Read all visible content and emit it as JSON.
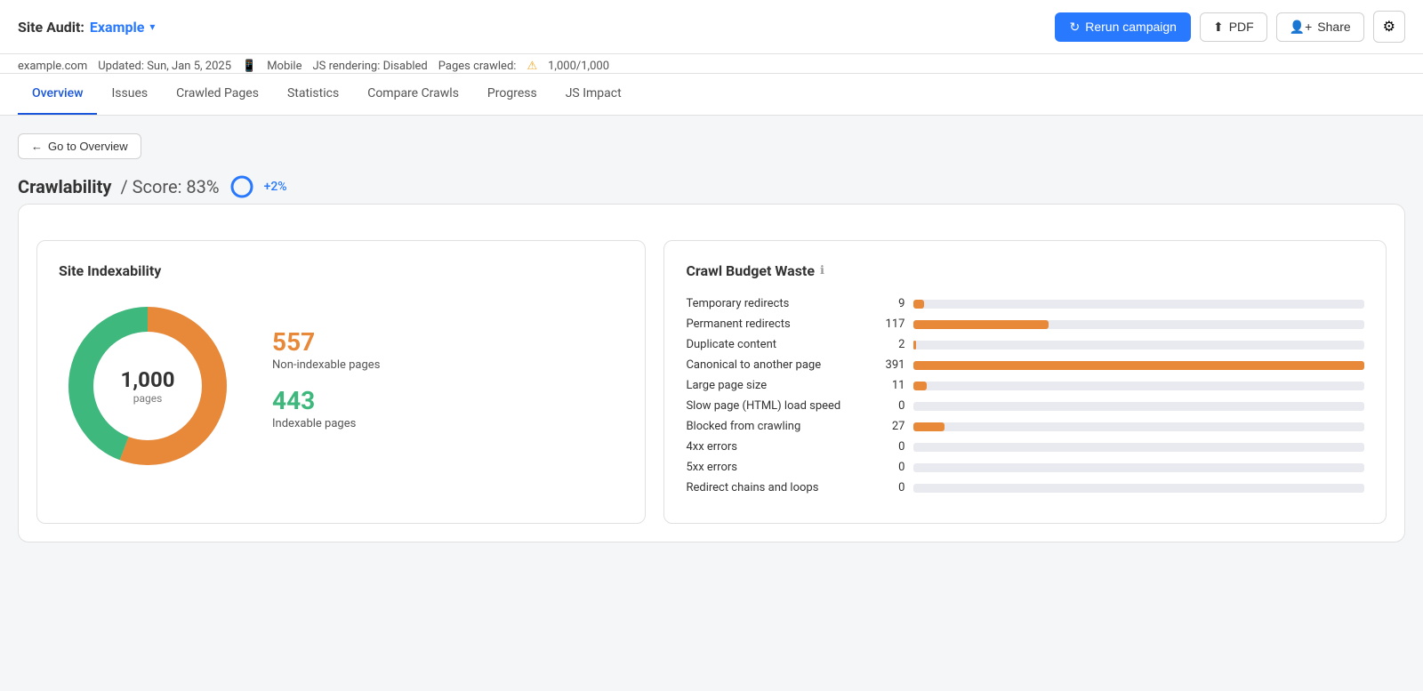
{
  "header": {
    "site_audit_label": "Site Audit:",
    "site_name": "Example",
    "chevron": "▾",
    "rerun_btn": "Rerun campaign",
    "pdf_btn": "PDF",
    "share_btn": "Share"
  },
  "subbar": {
    "domain": "example.com",
    "updated": "Updated: Sun, Jan 5, 2025",
    "device": "Mobile",
    "js_rendering": "JS rendering: Disabled",
    "pages_crawled_label": "Pages crawled:",
    "pages_crawled_value": "1,000/1,000"
  },
  "tabs": [
    {
      "label": "Overview",
      "active": true
    },
    {
      "label": "Issues",
      "active": false
    },
    {
      "label": "Crawled Pages",
      "active": false
    },
    {
      "label": "Statistics",
      "active": false
    },
    {
      "label": "Compare Crawls",
      "active": false
    },
    {
      "label": "Progress",
      "active": false
    },
    {
      "label": "JS Impact",
      "active": false
    }
  ],
  "go_to_overview": "Go to Overview",
  "page_title": "Crawlability",
  "score_label": "/ Score:",
  "score_pct": "83%",
  "score_change": "+2%",
  "site_indexability": {
    "title": "Site Indexability",
    "total": "1,000",
    "total_label": "pages",
    "non_indexable": "557",
    "non_indexable_label": "Non-indexable pages",
    "indexable": "443",
    "indexable_label": "Indexable pages",
    "non_indexable_pct": 55.7,
    "indexable_pct": 44.3
  },
  "crawl_budget": {
    "title": "Crawl Budget Waste",
    "rows": [
      {
        "label": "Temporary redirects",
        "count": 9,
        "bar_pct": 2.3
      },
      {
        "label": "Permanent redirects",
        "count": 117,
        "bar_pct": 30
      },
      {
        "label": "Duplicate content",
        "count": 2,
        "bar_pct": 0.5
      },
      {
        "label": "Canonical to another page",
        "count": 391,
        "bar_pct": 100
      },
      {
        "label": "Large page size",
        "count": 11,
        "bar_pct": 2.8
      },
      {
        "label": "Slow page (HTML) load speed",
        "count": 0,
        "bar_pct": 0
      },
      {
        "label": "Blocked from crawling",
        "count": 27,
        "bar_pct": 6.9
      },
      {
        "label": "4xx errors",
        "count": 0,
        "bar_pct": 0
      },
      {
        "label": "5xx errors",
        "count": 0,
        "bar_pct": 0
      },
      {
        "label": "Redirect chains and loops",
        "count": 0,
        "bar_pct": 0
      }
    ]
  },
  "colors": {
    "orange": "#e8893a",
    "green": "#3eb87c",
    "blue": "#2979ff",
    "bar_fill": "#e8893a",
    "bar_bg": "#e8eaf0"
  }
}
